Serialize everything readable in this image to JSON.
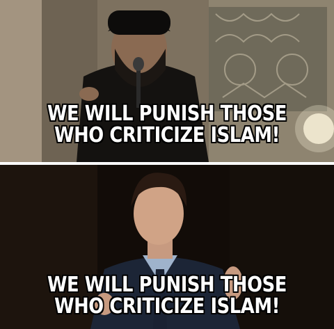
{
  "meme": {
    "top_panel": {
      "caption_line1": "WE WILL PUNISH THOSE",
      "caption_line2": "WHO CRITICIZE ISLAM!"
    },
    "bottom_panel": {
      "caption_line1": "WE WILL PUNISH THOSE",
      "caption_line2": "WHO CRITICIZE ISLAM!"
    }
  },
  "colors": {
    "caption_text": "#ffffff",
    "caption_outline": "#000000",
    "top_background": "#8a7c68",
    "bottom_background": "#0f0a07"
  }
}
